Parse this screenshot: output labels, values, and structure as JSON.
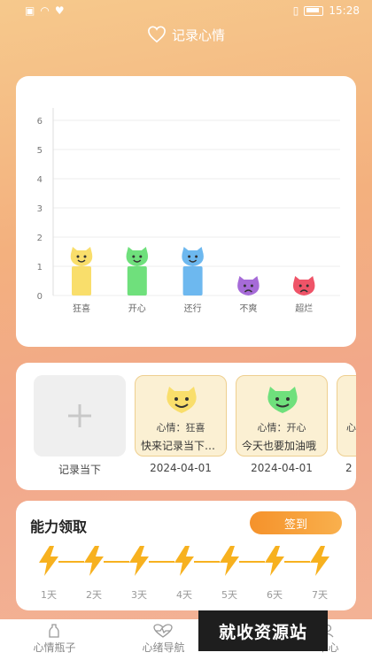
{
  "status_bar": {
    "time": "15:28"
  },
  "header": {
    "title": "记录心情"
  },
  "chart_data": {
    "type": "bar",
    "categories": [
      "狂喜",
      "开心",
      "还行",
      "不爽",
      "超烂"
    ],
    "values": [
      1,
      1,
      1,
      0,
      0
    ],
    "ylim": [
      0,
      6
    ],
    "yticks": [
      "0",
      "1",
      "2",
      "3",
      "4",
      "5",
      "6"
    ],
    "colors": [
      "#f9de6b",
      "#6fe07c",
      "#6db8ef",
      "#a66bd8",
      "#ef5468"
    ],
    "grid": true,
    "xlabel": "",
    "ylabel": ""
  },
  "records": {
    "add_label": "记录当下",
    "items": [
      {
        "mood": "心情：狂喜",
        "text": "快来记录当下的心情吧",
        "date": "2024-04-01",
        "color": "#f9de6b"
      },
      {
        "mood": "心情：开心",
        "text": "今天也要加油哦",
        "date": "2024-04-01",
        "color": "#6fe07c"
      },
      {
        "mood": "心情：",
        "text": "",
        "date": "2",
        "color": "#f9de6b"
      }
    ]
  },
  "ability": {
    "title": "能力领取",
    "signin_label": "签到",
    "days": [
      "1天",
      "2天",
      "3天",
      "4天",
      "5天",
      "6天",
      "7天"
    ]
  },
  "nav": {
    "items": [
      {
        "label": "心情瓶子",
        "icon": "bottle-icon"
      },
      {
        "label": "心绪导航",
        "icon": "heartbeat-icon"
      },
      {
        "label": "",
        "icon": ""
      },
      {
        "label": "中心",
        "icon": "user-icon"
      }
    ]
  },
  "watermark": "就收资源站"
}
